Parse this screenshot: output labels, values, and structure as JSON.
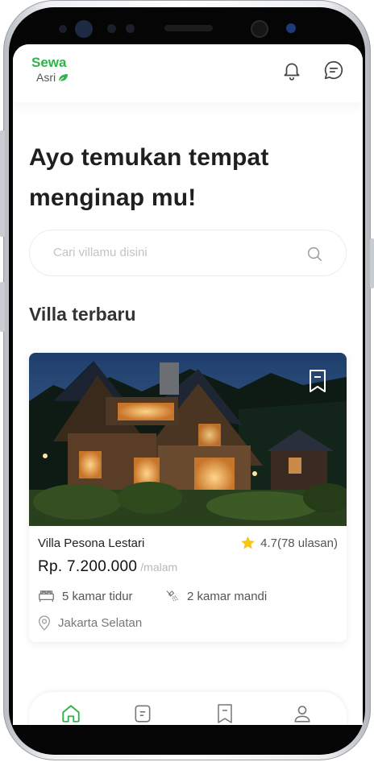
{
  "header": {
    "brand_title": "Sewa",
    "brand_sub": "Asri",
    "icons": [
      "bell-icon",
      "chat-icon"
    ]
  },
  "headline": "Ayo temukan tempat menginap mu!",
  "search": {
    "placeholder": "Cari villamu disini",
    "value": ""
  },
  "section_title": "Villa terbaru",
  "villa": {
    "name": "Villa Pesona Lestari",
    "rating": "4.7(78 ulasan)",
    "price": "Rp. 7.200.000",
    "per": "/malam",
    "bedrooms": "5 kamar tidur",
    "bathrooms": "2 kamar mandi",
    "location": "Jakarta Selatan"
  },
  "nav": {
    "items": [
      "home-icon",
      "document-icon",
      "bookmark-icon",
      "profile-icon"
    ],
    "active": "home-icon"
  },
  "colors": {
    "brand": "#2fb34a",
    "text_dark": "#1f1f1f",
    "muted": "#b8b8b8",
    "star": "#f5c518"
  }
}
